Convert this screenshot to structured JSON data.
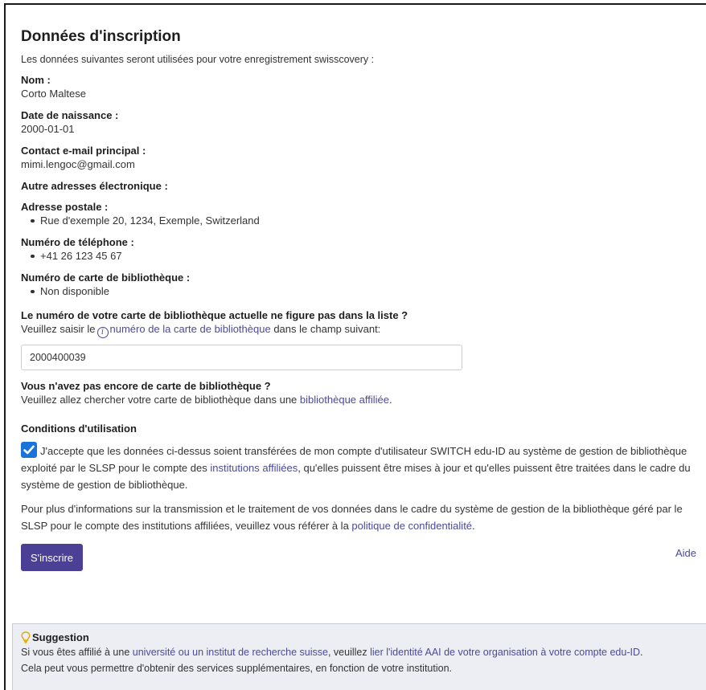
{
  "form": {
    "title": "Données d'inscription",
    "intro": "Les données suivantes seront utilisées pour votre enregistrement swisscovery :",
    "fields": {
      "name": {
        "label": "Nom :",
        "value": "Corto Maltese"
      },
      "birthdate": {
        "label": "Date de naissance :",
        "value": "2000-01-01"
      },
      "email": {
        "label": "Contact e-mail principal :",
        "value": "mimi.lengoc@gmail.com"
      },
      "other_emails": {
        "label": "Autre adresses électronique :"
      },
      "postal": {
        "label": "Adresse postale :",
        "items": [
          "Rue d'exemple 20, 1234, Exemple, Switzerland"
        ]
      },
      "phone": {
        "label": "Numéro de téléphone :",
        "items": [
          "+41 26 123 45 67"
        ]
      },
      "library_card": {
        "label": "Numéro de carte de bibliothèque :",
        "items": [
          "Non disponible"
        ]
      }
    },
    "card_missing": {
      "question": "Le numéro de votre carte de bibliothèque actuelle ne figure pas dans la liste ?",
      "prefix": "Veuillez saisir le",
      "info_icon": "info-icon",
      "link": "numéro de la carte de bibliothèque",
      "suffix": "dans le champ suivant:",
      "input_value": "2000400039"
    },
    "no_card": {
      "question": "Vous n'avez pas encore de carte de bibliothèque ?",
      "prefix": "Veuillez allez chercher votre carte de bibliothèque dans une",
      "link": "bibliothèque affiliée",
      "suffix": "."
    },
    "terms": {
      "title": "Conditions d'utilisation",
      "checked": true,
      "text_before": "J'accepte que les données ci-dessus soient transférées de mon compte d'utilisateur SWITCH edu-ID au système de gestion de bibliothèque exploité par le SLSP pour le compte des",
      "link": "institutions affiliées",
      "text_after": ", qu'elles puissent être mises à jour et qu'elles puissent être traitées dans le cadre du système de gestion de bibliothèque.",
      "info_before": "Pour plus d'informations sur la transmission et le traitement de vos données dans le cadre du système de gestion de la bibliothèque géré par le SLSP pour le compte des institutions affiliées, veuillez vous référer à la",
      "info_link": "politique de confidentialité",
      "info_after": "."
    },
    "submit_label": "S'inscrire",
    "help_label": "Aide"
  },
  "suggestion": {
    "icon": "lightbulb-icon",
    "title": "Suggestion",
    "text1": "Si vous êtes affilié à une",
    "link1": "université ou un institut de recherche suisse",
    "text2": ", veuillez",
    "link2": "lier l'identité AAI de votre organisation à votre compte edu-ID",
    "text3": ".",
    "text4": "Cela peut vous permettre d'obtenir des services supplémentaires, en fonction de votre institution."
  },
  "colors": {
    "primary_button": "#4b3f96",
    "link": "#4a4a9c",
    "checkbox": "#1a73d9",
    "suggestion_bg": "#eceef3"
  }
}
